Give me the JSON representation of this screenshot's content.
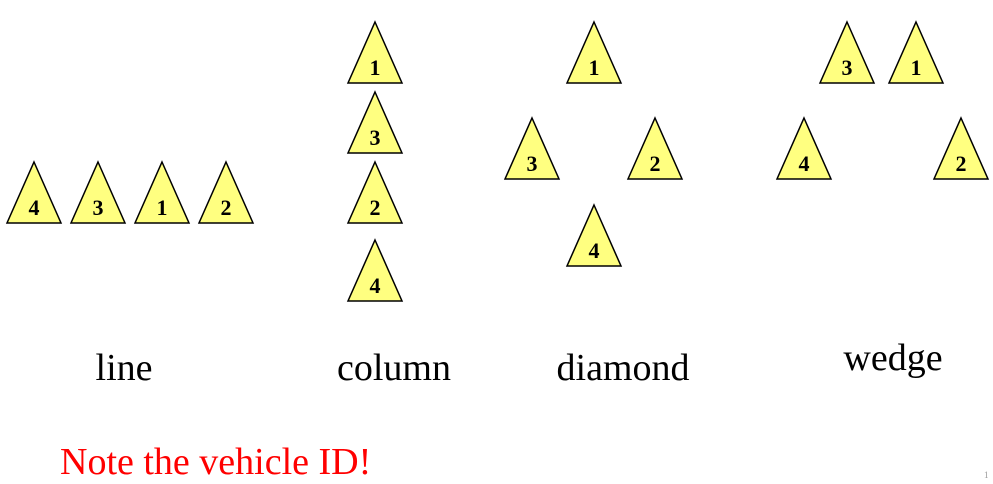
{
  "formations": [
    {
      "name": "line",
      "label": "line",
      "vehicles": [
        "4",
        "3",
        "1",
        "2"
      ]
    },
    {
      "name": "column",
      "label": "column",
      "vehicles": [
        "1",
        "3",
        "2",
        "4"
      ]
    },
    {
      "name": "diamond",
      "label": "diamond",
      "vehicles": [
        "1",
        "3",
        "2",
        "4"
      ]
    },
    {
      "name": "wedge",
      "label": "wedge",
      "vehicles": [
        "3",
        "1",
        "4",
        "2"
      ]
    }
  ],
  "note": "Note the vehicle ID!",
  "page_number": "1",
  "colors": {
    "vehicle_fill": "#ffff80",
    "stroke": "#000000",
    "note": "#ff0000"
  }
}
